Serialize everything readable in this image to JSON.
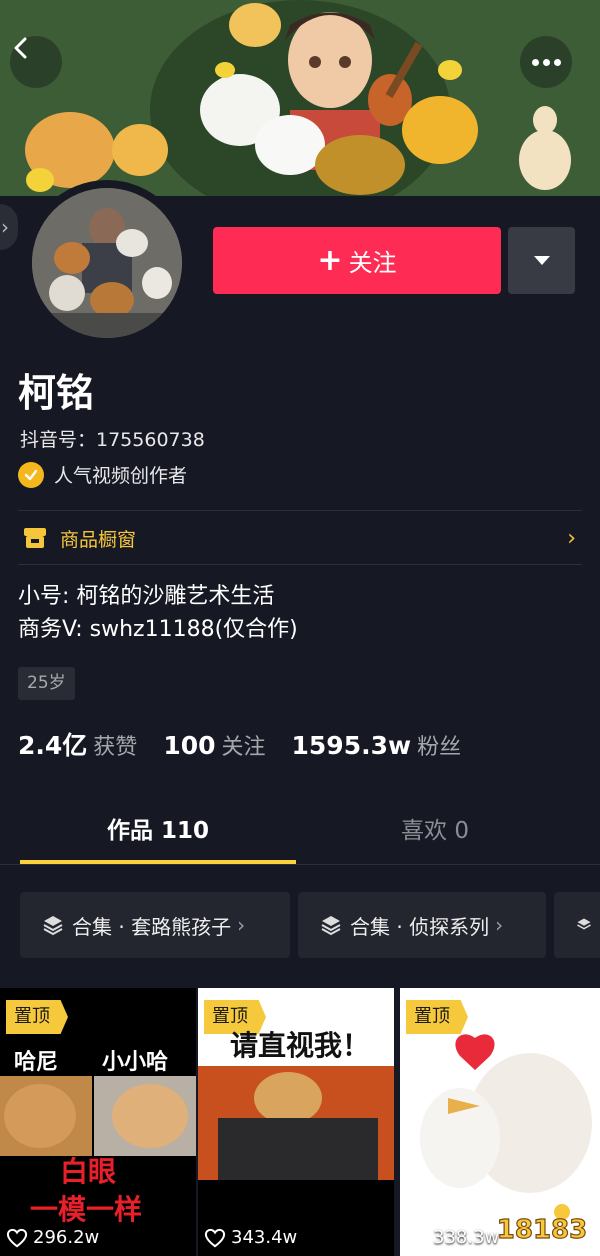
{
  "profile": {
    "name": "柯铭",
    "douyin_id": "抖音号：175560738",
    "badge": "人气视频创作者",
    "bio_line1": "小号: 柯铭的沙雕艺术生活",
    "bio_line2": "商务V: swhz11188(仅合作)",
    "age_tag": "25岁"
  },
  "actions": {
    "follow_label": "关注",
    "follow_plus": "+"
  },
  "shop": {
    "label": "商品橱窗"
  },
  "stats": [
    {
      "value": "2.4亿",
      "label": "获赞"
    },
    {
      "value": "100",
      "label": "关注"
    },
    {
      "value": "1595.3w",
      "label": "粉丝"
    }
  ],
  "tabs": [
    {
      "label": "作品 110",
      "active": true
    },
    {
      "label": "喜欢 0",
      "active": false
    }
  ],
  "collections": [
    {
      "label": "合集 · 套路熊孩子"
    },
    {
      "label": "合集 · 侦探系列"
    }
  ],
  "videos": [
    {
      "pinned": "置顶",
      "likes": "296.2w",
      "overlay_names": [
        "哈尼",
        "小小哈"
      ],
      "overlay_caption": [
        "白眼",
        "一模一样"
      ]
    },
    {
      "pinned": "置顶",
      "likes": "343.4w",
      "overlay_caption": [
        "请直视我！"
      ]
    },
    {
      "pinned": "置顶",
      "likes": "338.3w"
    }
  ],
  "watermark": "18183",
  "colors": {
    "background": "#161823",
    "follow_button": "#fe2c55",
    "accent_yellow": "#f6c93c",
    "badge": "#f5b81c"
  }
}
